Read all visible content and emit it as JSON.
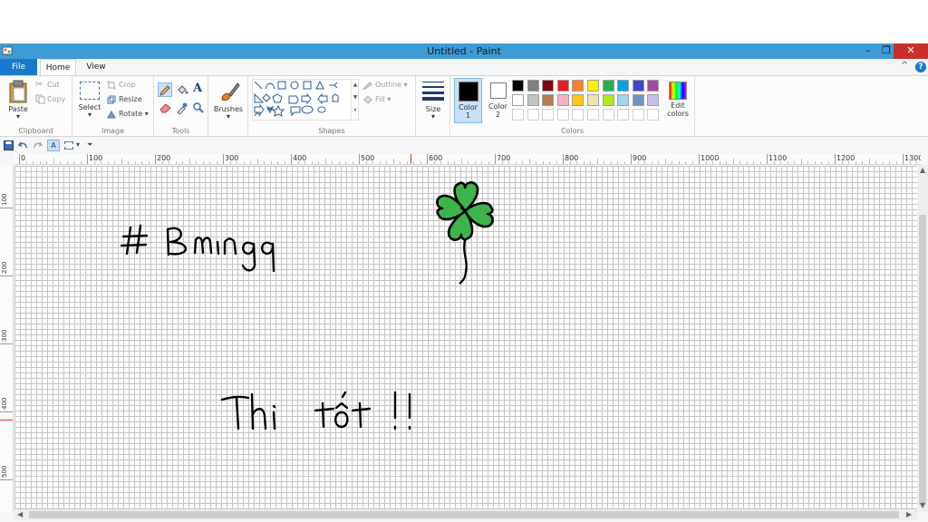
{
  "window": {
    "title": "Untitled - Paint",
    "minimize_icon": "minimize-icon",
    "maximize_icon": "restore-icon",
    "close_icon": "close-icon",
    "min_glyph": "–",
    "max_glyph": "❐",
    "close_glyph": "✕"
  },
  "tabs": {
    "file": "File",
    "home": "Home",
    "view": "View",
    "collapse_glyph": "^",
    "help_glyph": "?"
  },
  "clipboard": {
    "paste": "Paste",
    "cut": "Cut",
    "copy": "Copy",
    "label": "Clipboard"
  },
  "image": {
    "select": "Select",
    "crop": "Crop",
    "resize": "Resize",
    "rotate": "Rotate",
    "label": "Image"
  },
  "tools": {
    "label": "Tools",
    "text_tool_glyph": "A"
  },
  "brushes": {
    "label": "Brushes"
  },
  "shapes": {
    "label": "Shapes",
    "outline": "Outline",
    "fill": "Fill"
  },
  "size": {
    "label": "Size"
  },
  "colors": {
    "label": "Colors",
    "color1_line1": "Color",
    "color1_line2": "1",
    "color2_line1": "Color",
    "color2_line2": "2",
    "edit_line1": "Edit",
    "edit_line2": "colors",
    "color1_value": "#000000",
    "color2_value": "#ffffff",
    "palette_row1": [
      "#000000",
      "#7f7f7f",
      "#880015",
      "#ed1c24",
      "#ff7f27",
      "#fff200",
      "#22b14c",
      "#00a2e8",
      "#3f48cc",
      "#a349a4"
    ],
    "palette_row2": [
      "#ffffff",
      "#c3c3c3",
      "#b97a57",
      "#ffaec9",
      "#ffc90e",
      "#efe4b0",
      "#b5e61d",
      "#99d9ea",
      "#7092be",
      "#c8bfe7"
    ],
    "palette_row3": [
      "#ffffff",
      "#ffffff",
      "#ffffff",
      "#ffffff",
      "#ffffff",
      "#ffffff",
      "#ffffff",
      "#ffffff",
      "#ffffff",
      "#ffffff"
    ]
  },
  "rulers": {
    "horizontal": [
      "0",
      "100",
      "200",
      "300",
      "400",
      "500",
      "600",
      "700",
      "800",
      "900",
      "1000",
      "1100",
      "1200",
      "1300"
    ],
    "vertical": [
      "100",
      "200",
      "300",
      "400",
      "500"
    ]
  },
  "canvas": {
    "handwriting_1": "# Bmingg",
    "handwriting_2": "Thi tốt !!",
    "drawing": "four-leaf-clover",
    "ink_color": "#000000",
    "clover_color": "#3cb44b"
  }
}
